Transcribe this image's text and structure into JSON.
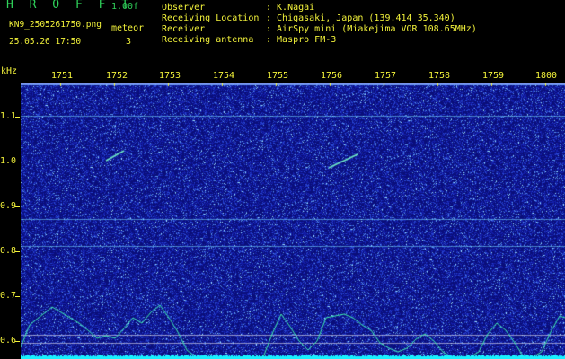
{
  "header": {
    "brand": "H R O F F T",
    "version": "1.00f",
    "filename": "KN9_2505261750.png",
    "meteor_label": "meteor",
    "meteor_count": "3",
    "datetime": "25.05.26 17:50",
    "info": [
      {
        "key": "Observer",
        "value": ": K.Nagai"
      },
      {
        "key": "Receiving Location",
        "value": ": Chigasaki, Japan (139.414 35.340)"
      },
      {
        "key": "Receiver",
        "value": ": AirSpy mini (Miakejima VOR 108.65MHz)"
      },
      {
        "key": "Receiving antenna",
        "value": ": Maspro FM-3"
      }
    ]
  },
  "plot": {
    "y_unit": "kHz",
    "y_ticks": [
      "1.1",
      "1.0",
      "0.9",
      "0.8",
      "0.7",
      "0.6"
    ],
    "x_ticks": [
      "1751",
      "1752",
      "1753",
      "1754",
      "1755",
      "1756",
      "1757",
      "1758",
      "1759",
      "1800"
    ],
    "colors": {
      "noise": "#1b22a8",
      "trace": "#3ff0b0",
      "floor": "#19f0ff",
      "label": "#f2f23a"
    }
  }
}
